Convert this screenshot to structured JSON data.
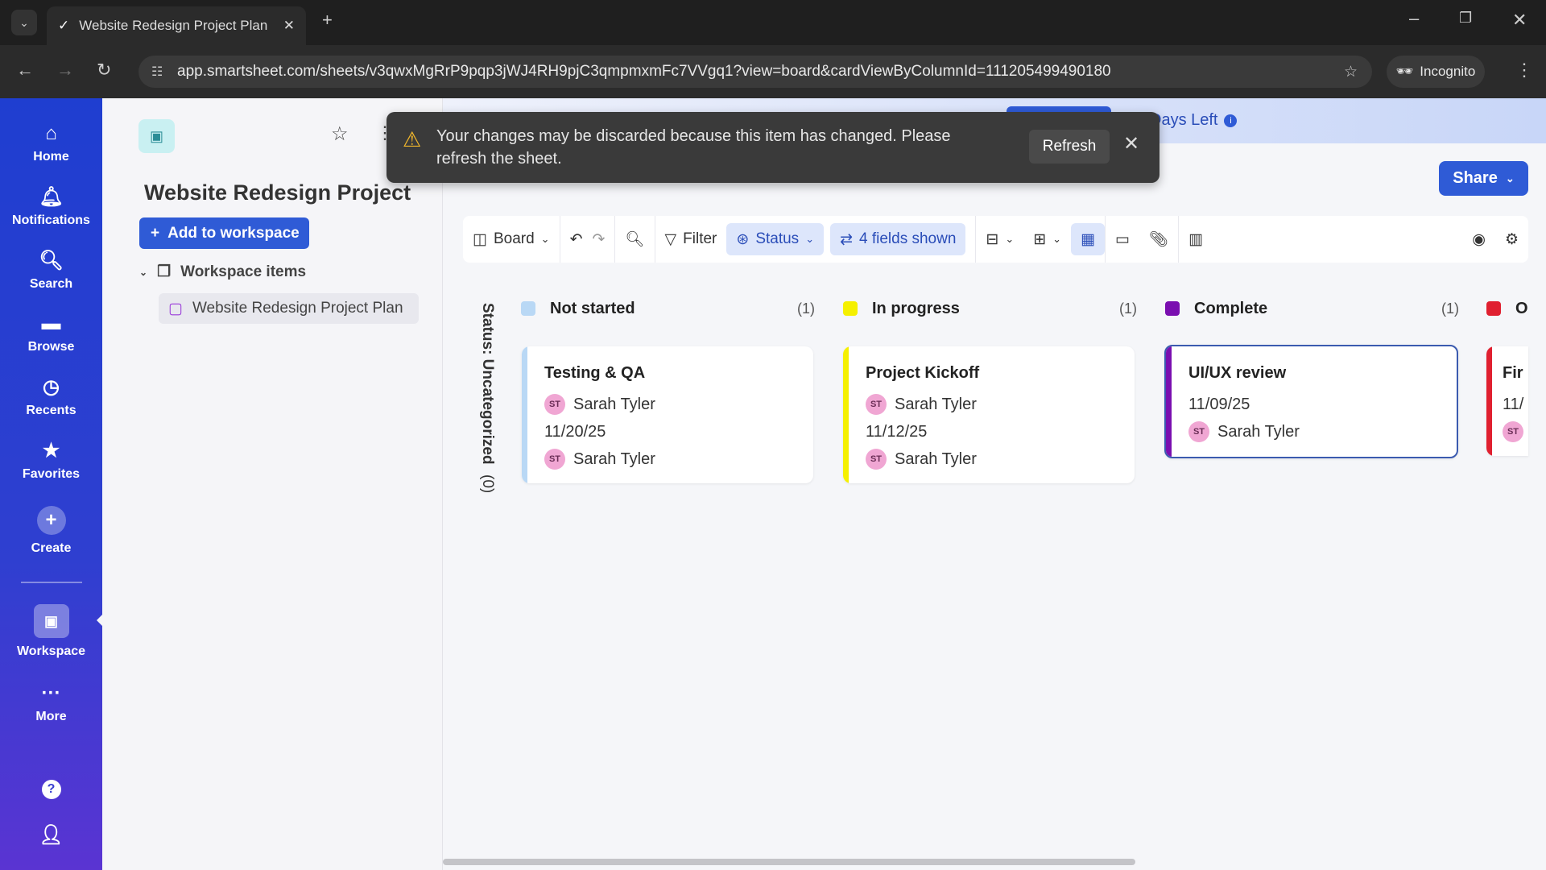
{
  "browser": {
    "tab_title": "Website Redesign Project Plan",
    "url": "app.smartsheet.com/sheets/v3qwxMgRrP9pqp3jWJ4RH9pjC3qmpmxmFc7VVgq1?view=board&cardViewByColumnId=111205499490180",
    "incognito_label": "Incognito"
  },
  "nav": {
    "items": [
      {
        "label": "Home",
        "icon": "home-icon"
      },
      {
        "label": "Notifications",
        "icon": "bell-icon"
      },
      {
        "label": "Search",
        "icon": "search-icon"
      },
      {
        "label": "Browse",
        "icon": "folder-icon"
      },
      {
        "label": "Recents",
        "icon": "clock-icon"
      },
      {
        "label": "Favorites",
        "icon": "star-icon"
      },
      {
        "label": "Create",
        "icon": "plus-icon"
      },
      {
        "label": "Workspace",
        "icon": "workspace-icon"
      },
      {
        "label": "More",
        "icon": "more-icon"
      }
    ]
  },
  "panel": {
    "title": "Website Redesign Project",
    "add_button": "Add to workspace",
    "section": "Workspace items",
    "items": [
      "Website Redesign Project Plan"
    ]
  },
  "banner": {
    "days_left": "Days Left"
  },
  "toast": {
    "message": "Your changes may be discarded because this item has changed. Please refresh the sheet.",
    "action": "Refresh"
  },
  "header": {
    "share": "Share"
  },
  "toolbar": {
    "view": "Board",
    "filter": "Filter",
    "group": "Status",
    "fields": "4 fields shown"
  },
  "board": {
    "uncategorized": "Status: Uncategorized",
    "uncategorized_count": "(0)",
    "columns": [
      {
        "name": "Not started",
        "count": "(1)",
        "color": "#b9d8f5",
        "cards": [
          {
            "title": "Testing & QA",
            "assignee": "Sarah Tyler",
            "date": "11/20/25",
            "assignee2": "Sarah Tyler",
            "initials": "ST"
          }
        ]
      },
      {
        "name": "In progress",
        "count": "(1)",
        "color": "#f5f000",
        "cards": [
          {
            "title": "Project Kickoff",
            "assignee": "Sarah Tyler",
            "date": "11/12/25",
            "assignee2": "Sarah Tyler",
            "initials": "ST"
          }
        ]
      },
      {
        "name": "Complete",
        "count": "(1)",
        "color": "#7a0fb0",
        "cards": [
          {
            "title": "UI/UX review",
            "date": "11/09/25",
            "assignee": "Sarah Tyler",
            "initials": "ST"
          }
        ]
      },
      {
        "name": "O",
        "color": "#e02030",
        "cards": [
          {
            "title": "Fir",
            "date": "11/",
            "initials": "ST"
          }
        ]
      }
    ]
  }
}
